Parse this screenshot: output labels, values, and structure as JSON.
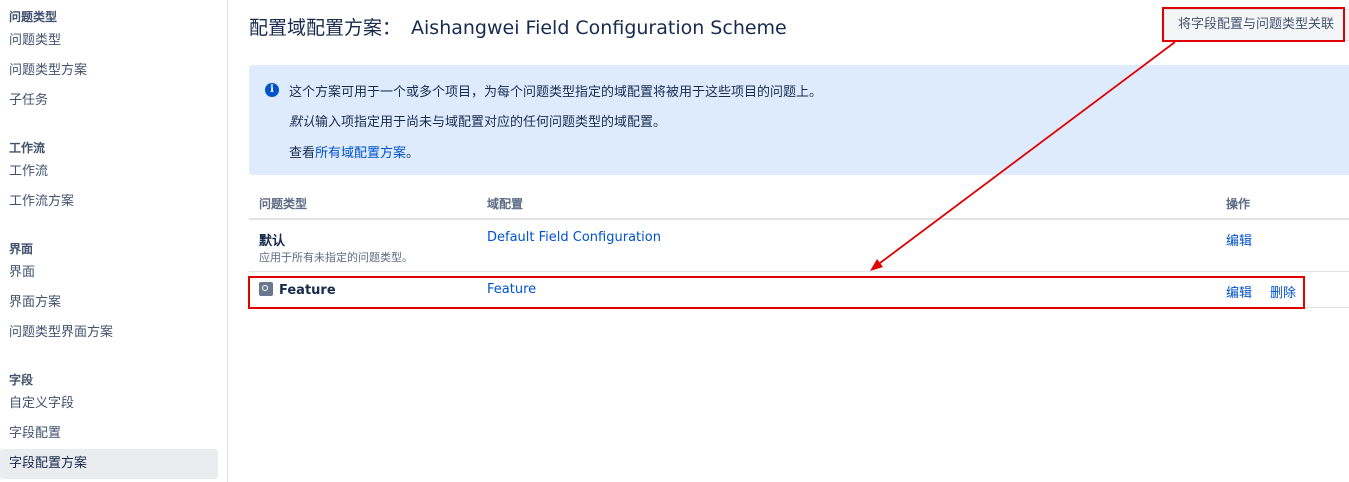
{
  "sidebar": {
    "sections": [
      {
        "heading": "问题类型",
        "items": [
          "问题类型",
          "问题类型方案",
          "子任务"
        ]
      },
      {
        "heading": "工作流",
        "items": [
          "工作流",
          "工作流方案"
        ]
      },
      {
        "heading": "界面",
        "items": [
          "界面",
          "界面方案",
          "问题类型界面方案"
        ]
      },
      {
        "heading": "字段",
        "items": [
          "自定义字段",
          "字段配置",
          "字段配置方案"
        ]
      }
    ],
    "active_item": "字段配置方案"
  },
  "header": {
    "title_prefix": "配置域配置方案：",
    "scheme_name": "Aishangwei Field Configuration Scheme",
    "associate_button": "将字段配置与问题类型关联"
  },
  "info": {
    "line1": "这个方案可用于一个或多个项目，为每个问题类型指定的域配置将被用于这些项目的问题上。",
    "line2_em": "默认",
    "line2_rest": "输入项指定用于尚未与域配置对应的任何问题类型的域配置。",
    "line3_prefix": "查看",
    "line3_link": "所有域配置方案",
    "line3_suffix": "。"
  },
  "table": {
    "headers": {
      "issue_type": "问题类型",
      "field_config": "域配置",
      "actions": "操作"
    },
    "rows": [
      {
        "issue_type": "默认",
        "description": "应用于所有未指定的问题类型。",
        "field_config": "Default Field Configuration",
        "actions": [
          "编辑"
        ]
      },
      {
        "issue_type": "Feature",
        "description": "",
        "field_config": "Feature",
        "actions": [
          "编辑",
          "删除"
        ]
      }
    ]
  },
  "colors": {
    "accent": "#0052cc",
    "annotation": "#e00000",
    "info_bg": "#deebff"
  }
}
